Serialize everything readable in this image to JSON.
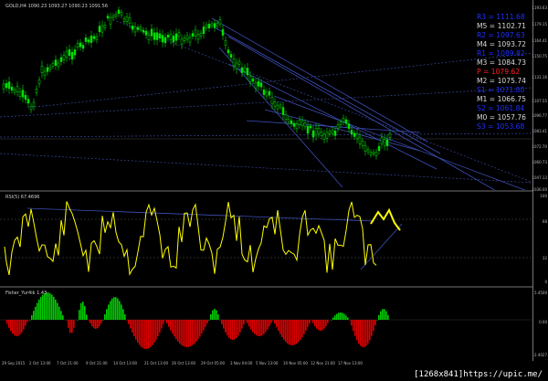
{
  "chart": {
    "symbol_label": "GOLD,H4  1090.23 1093.27 1090.23 1091.56",
    "rsi_label": "RSI(5) 67.4696",
    "fisher_label": "Fisher_Yur4ik 1.43"
  },
  "pivots": [
    {
      "label": "R3 = 1111.68",
      "color": "#1f2fff"
    },
    {
      "label": "M5 = 1102.71",
      "color": "#d8d8d8"
    },
    {
      "label": "R2 = 1097.63",
      "color": "#1f2fff"
    },
    {
      "label": "M4 = 1093.72",
      "color": "#d8d8d8"
    },
    {
      "label": "R1 = 1089.82",
      "color": "#1f2fff"
    },
    {
      "label": "M3 = 1084.73",
      "color": "#d8d8d8"
    },
    {
      "label": "P  = 1079.62",
      "color": "#ff2020"
    },
    {
      "label": "M2 = 1075.74",
      "color": "#d8d8d8"
    },
    {
      "label": "S1 = 1071.80",
      "color": "#1f2fff"
    },
    {
      "label": "M1 = 1066.75",
      "color": "#d8d8d8"
    },
    {
      "label": "S2 = 1061.84",
      "color": "#1f2fff"
    },
    {
      "label": "M0 = 1057.76",
      "color": "#d8d8d8"
    },
    {
      "label": "S3 = 1053.68",
      "color": "#1f2fff"
    }
  ],
  "price_axis": [
    "1193.63",
    "1179.15",
    "1164.41",
    "1150.75",
    "1131.16",
    "1107.55",
    "1096.77",
    "1083.41",
    "1072.70",
    "1060.73",
    "1047.13",
    "1036.00"
  ],
  "rsi_axis": [
    "100",
    "68",
    "32",
    "0"
  ],
  "fisher_axis": [
    "5.4500",
    "0.00",
    "-2.4027"
  ],
  "time_axis": [
    "29 Sep 2015",
    "2 Oct 13:00",
    "7 Oct 21:00",
    "9 Oct 21:00",
    "14 Oct 13:00",
    "21 Oct 13:00",
    "26 Oct 13:00",
    "29 Oct 05:00",
    "3 Nov 04:00",
    "5 Nov 13:00",
    "10 Nov 05:00",
    "12 Nov 21:00",
    "17 Nov 13:00"
  ],
  "watermark": "[1268x841]https://upic.me/",
  "colors": {
    "candle": "#00e000",
    "rsi": "#ffff00",
    "fisher_pos": "#00cc00",
    "fisher_neg": "#dd0000",
    "trendline": "#3e4fb8",
    "pivot_dots": "#39479a"
  }
}
